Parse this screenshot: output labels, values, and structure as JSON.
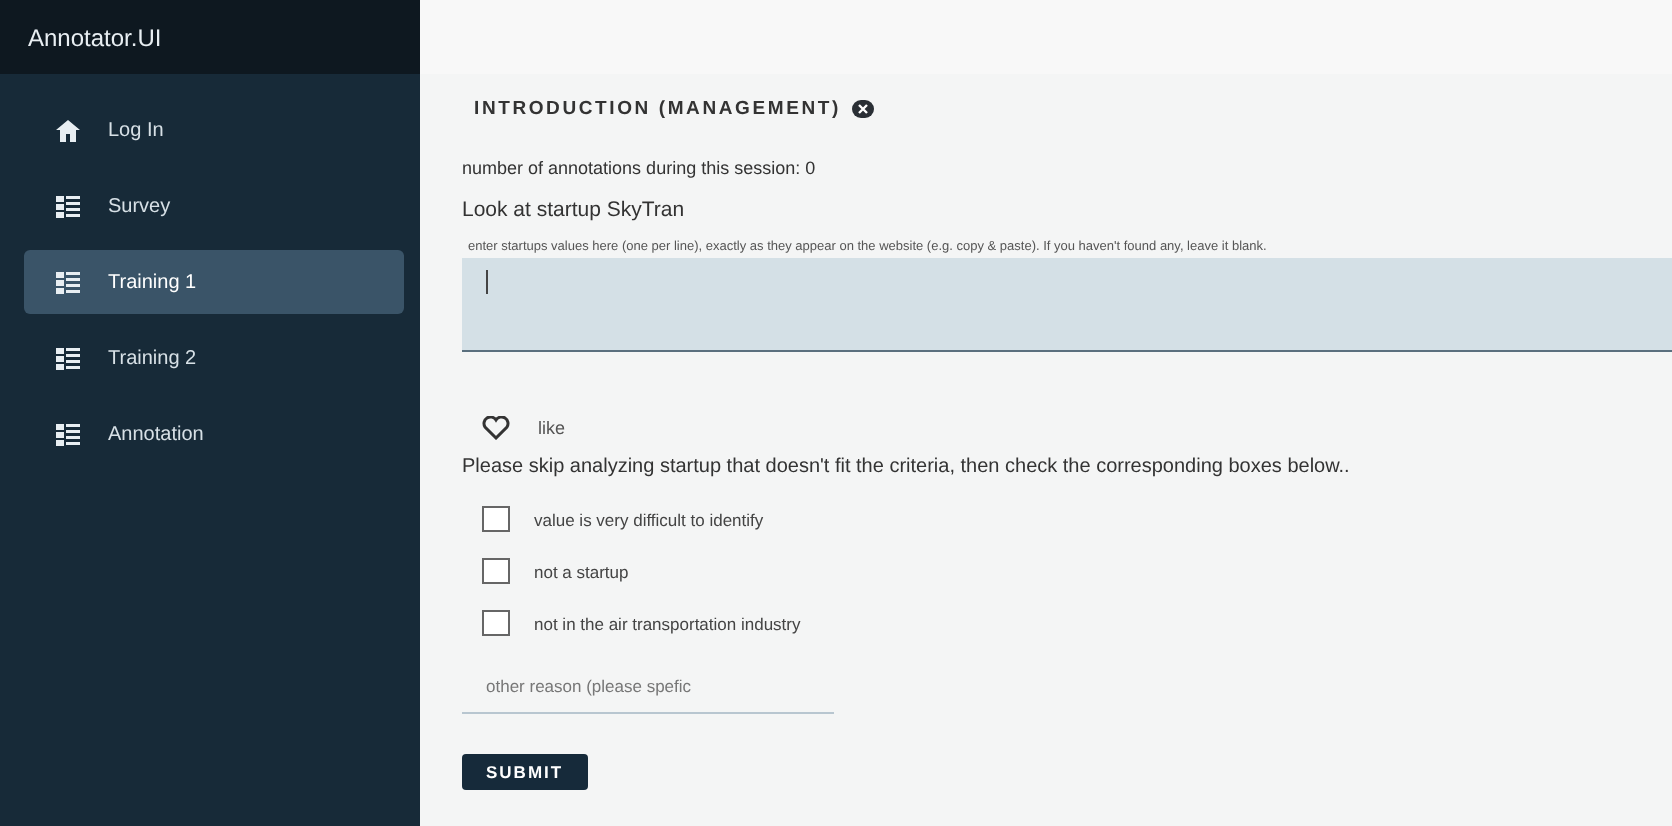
{
  "app_title": "Annotator.UI",
  "nav": [
    {
      "label": "Log In",
      "kind": "home",
      "selected": false
    },
    {
      "label": "Survey",
      "kind": "list",
      "selected": false
    },
    {
      "label": "Training 1",
      "kind": "list",
      "selected": true
    },
    {
      "label": "Training 2",
      "kind": "list",
      "selected": false
    },
    {
      "label": "Annotation",
      "kind": "list",
      "selected": false
    }
  ],
  "section_title": "INTRODUCTION (MANAGEMENT)",
  "count_text": "number of annotations during this session: 0",
  "prompt": "Look at startup SkyTran",
  "textarea": {
    "label": "enter startups values here (one per line), exactly as they appear on the website (e.g. copy & paste). If you haven't found any, leave it blank."
  },
  "like": {
    "label": "like",
    "liked": false
  },
  "instruction": "Please skip analyzing startup that doesn't fit the criteria, then check the corresponding boxes below..",
  "reasons": [
    {
      "label": "value is very difficult to identify",
      "checked": false
    },
    {
      "label": "not a startup",
      "checked": false
    },
    {
      "label": "not in the air transportation industry",
      "checked": false
    }
  ],
  "other_reason": {
    "placeholder": "other reason (please spefic"
  },
  "submit": "SUBMIT"
}
